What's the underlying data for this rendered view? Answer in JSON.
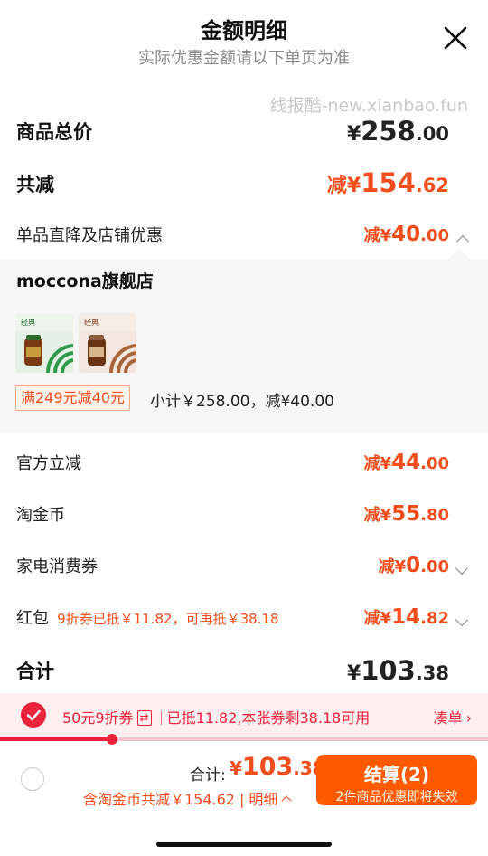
{
  "header": {
    "title": "金额明细",
    "subtitle": "实际优惠金额请以下单页为准",
    "close_icon": "close-icon"
  },
  "watermark": "线报酷-new.xianbao.fun",
  "summary": {
    "goods_total": {
      "label": "商品总价",
      "yen": "¥",
      "int": "258",
      "dec": ".00"
    },
    "total_reduce": {
      "label": "共减",
      "prefix": "减",
      "yen": "¥",
      "int": "154",
      "dec": ".62"
    },
    "item_discount": {
      "label": "单品直降及店铺优惠",
      "prefix": "减",
      "yen": "¥",
      "int": "40",
      "dec": ".00",
      "expanded": true
    }
  },
  "shop": {
    "name": "moccona旗舰店",
    "promo_tag": "满249元减40元",
    "subtotal": "小计￥258.00，减¥40.00",
    "thumbnails": [
      "product-thumbnail-green",
      "product-thumbnail-brown"
    ]
  },
  "discounts": [
    {
      "label": "官方立减",
      "prefix": "减",
      "yen": "¥",
      "int": "44",
      "dec": ".00"
    },
    {
      "label": "淘金币",
      "prefix": "减",
      "yen": "¥",
      "int": "55",
      "dec": ".80"
    },
    {
      "label": "家电消费券",
      "prefix": "减",
      "yen": "¥",
      "int": "0",
      "dec": ".00"
    },
    {
      "label": "红包",
      "note": "9折券已抵￥11.82，可再抵￥38.18",
      "prefix": "减",
      "yen": "¥",
      "int": "14",
      "dec": ".82"
    }
  ],
  "combined": {
    "label": "合计",
    "yen": "¥",
    "int": "103",
    "dec": ".38"
  },
  "coupon_bar": {
    "coupon": "50元9折券",
    "swap": "⇄",
    "status": "已抵11.82,本张券剩38.18可用",
    "action": "凑单",
    "progress": 0.23
  },
  "footer": {
    "total_label": "合计:",
    "yen": "¥",
    "int": "103",
    "dec": ".38",
    "sub_note": "含淘金币共减￥154.62",
    "detail_link": "明细",
    "checkout_label": "结算(2)",
    "checkout_note": "2件商品优惠即将失效"
  },
  "colors": {
    "accent": "#f24d1c",
    "coupon_red": "#e8233a",
    "checkout": "#ff5a00"
  }
}
